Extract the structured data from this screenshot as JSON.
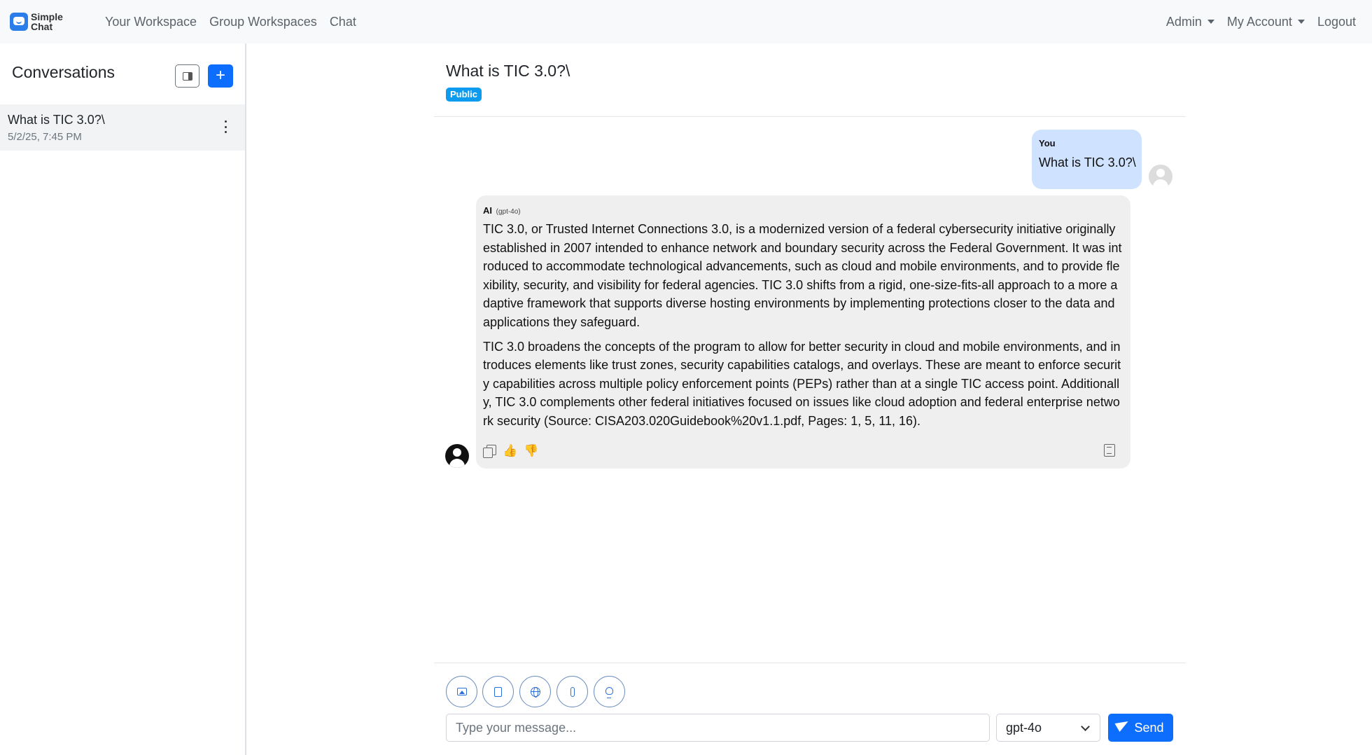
{
  "nav": {
    "brand_line1": "Simple",
    "brand_line2": "Chat",
    "links": [
      "Your Workspace",
      "Group Workspaces",
      "Chat"
    ],
    "admin": "Admin",
    "account": "My Account",
    "logout": "Logout"
  },
  "sidebar": {
    "title": "Conversations",
    "new_button": "+",
    "conversations": [
      {
        "title": "What is TIC 3.0?\\",
        "date": "5/2/25, 7:45 PM"
      }
    ]
  },
  "chat": {
    "title": "What is TIC 3.0?\\",
    "badge": "Public",
    "user_message": {
      "sender": "You",
      "text": "What is TIC 3.0?\\"
    },
    "ai_message": {
      "sender": "AI",
      "model": "(gpt-4o)",
      "paragraphs": [
        "TIC 3.0, or Trusted Internet Connections 3.0, is a modernized version of a federal cybersecurity initiative originally established in 2007 intended to enhance network and boundary security across the Federal Government. It was introduced to accommodate technological advancements, such as cloud and mobile environments, and to provide flexibility, security, and visibility for federal agencies. TIC 3.0 shifts from a rigid, one-size-fits-all approach to a more adaptive framework that supports diverse hosting environments by implementing protections closer to the data and applications they safeguard.",
        "TIC 3.0 broadens the concepts of the program to allow for better security in cloud and mobile environments, and introduces elements like trust zones, security capabilities catalogs, and overlays. These are meant to enforce security capabilities across multiple policy enforcement points (PEPs) rather than at a single TIC access point. Additionally, TIC 3.0 complements other federal initiatives focused on issues like cloud adoption and federal enterprise network security (Source: CISA203.020Guidebook%20v1.1.pdf, Pages: 1, 5, 11, 16)."
      ]
    }
  },
  "input": {
    "placeholder": "Type your message...",
    "value": "",
    "model": "gpt-4o",
    "send": "Send"
  },
  "icons": {
    "toolbar": [
      "image-icon",
      "document-icon",
      "globe-icon",
      "paperclip-icon",
      "lightbulb-icon"
    ],
    "actions": [
      "copy-icon",
      "thumbs-up-icon",
      "thumbs-down-icon",
      "citations-icon"
    ]
  },
  "colors": {
    "primary": "#0d6efd",
    "badge": "#0d9bf0",
    "user_bubble": "#cfe2ff",
    "ai_bubble": "#efefef"
  }
}
